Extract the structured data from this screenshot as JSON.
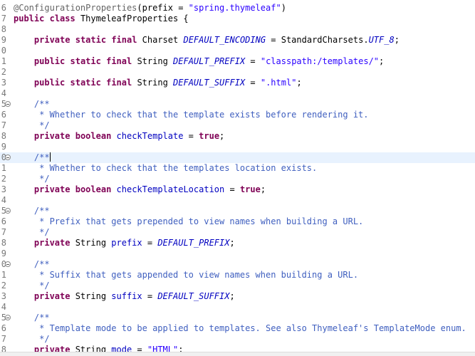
{
  "editor": {
    "lines": [
      {
        "num": "6",
        "fold": false,
        "current": false,
        "tokens": [
          {
            "t": "@ConfigurationProperties",
            "c": "ann"
          },
          {
            "t": "(prefix = ",
            "c": "plain"
          },
          {
            "t": "\"spring.thymeleaf\"",
            "c": "str"
          },
          {
            "t": ")",
            "c": "plain"
          }
        ]
      },
      {
        "num": "7",
        "fold": false,
        "current": false,
        "tokens": [
          {
            "t": "public",
            "c": "kw"
          },
          {
            "t": " ",
            "c": "plain"
          },
          {
            "t": "class",
            "c": "kw"
          },
          {
            "t": " ThymeleafProperties {",
            "c": "plain"
          }
        ]
      },
      {
        "num": "8",
        "fold": false,
        "current": false,
        "tokens": []
      },
      {
        "num": "9",
        "fold": false,
        "current": false,
        "tokens": [
          {
            "t": "    ",
            "c": "plain"
          },
          {
            "t": "private",
            "c": "kw"
          },
          {
            "t": " ",
            "c": "plain"
          },
          {
            "t": "static",
            "c": "kw"
          },
          {
            "t": " ",
            "c": "plain"
          },
          {
            "t": "final",
            "c": "kw"
          },
          {
            "t": " Charset ",
            "c": "plain"
          },
          {
            "t": "DEFAULT_ENCODING",
            "c": "const"
          },
          {
            "t": " = StandardCharsets.",
            "c": "plain"
          },
          {
            "t": "UTF_8",
            "c": "const"
          },
          {
            "t": ";",
            "c": "plain"
          }
        ]
      },
      {
        "num": "0",
        "fold": false,
        "current": false,
        "tokens": []
      },
      {
        "num": "1",
        "fold": false,
        "current": false,
        "tokens": [
          {
            "t": "    ",
            "c": "plain"
          },
          {
            "t": "public",
            "c": "kw"
          },
          {
            "t": " ",
            "c": "plain"
          },
          {
            "t": "static",
            "c": "kw"
          },
          {
            "t": " ",
            "c": "plain"
          },
          {
            "t": "final",
            "c": "kw"
          },
          {
            "t": " String ",
            "c": "plain"
          },
          {
            "t": "DEFAULT_PREFIX",
            "c": "const"
          },
          {
            "t": " = ",
            "c": "plain"
          },
          {
            "t": "\"classpath:/templates/\"",
            "c": "str"
          },
          {
            "t": ";",
            "c": "plain"
          }
        ]
      },
      {
        "num": "2",
        "fold": false,
        "current": false,
        "tokens": []
      },
      {
        "num": "3",
        "fold": false,
        "current": false,
        "tokens": [
          {
            "t": "    ",
            "c": "plain"
          },
          {
            "t": "public",
            "c": "kw"
          },
          {
            "t": " ",
            "c": "plain"
          },
          {
            "t": "static",
            "c": "kw"
          },
          {
            "t": " ",
            "c": "plain"
          },
          {
            "t": "final",
            "c": "kw"
          },
          {
            "t": " String ",
            "c": "plain"
          },
          {
            "t": "DEFAULT_SUFFIX",
            "c": "const"
          },
          {
            "t": " = ",
            "c": "plain"
          },
          {
            "t": "\".html\"",
            "c": "str"
          },
          {
            "t": ";",
            "c": "plain"
          }
        ]
      },
      {
        "num": "4",
        "fold": false,
        "current": false,
        "tokens": []
      },
      {
        "num": "5",
        "fold": true,
        "current": false,
        "tokens": [
          {
            "t": "    /**",
            "c": "doc"
          }
        ]
      },
      {
        "num": "6",
        "fold": false,
        "current": false,
        "tokens": [
          {
            "t": "     * Whether to check that the template exists before rendering it.",
            "c": "doc"
          }
        ]
      },
      {
        "num": "7",
        "fold": false,
        "current": false,
        "tokens": [
          {
            "t": "     */",
            "c": "doc"
          }
        ]
      },
      {
        "num": "8",
        "fold": false,
        "current": false,
        "tokens": [
          {
            "t": "    ",
            "c": "plain"
          },
          {
            "t": "private",
            "c": "kw"
          },
          {
            "t": " ",
            "c": "plain"
          },
          {
            "t": "boolean",
            "c": "kw"
          },
          {
            "t": " ",
            "c": "plain"
          },
          {
            "t": "checkTemplate",
            "c": "field"
          },
          {
            "t": " = ",
            "c": "plain"
          },
          {
            "t": "true",
            "c": "kw"
          },
          {
            "t": ";",
            "c": "plain"
          }
        ]
      },
      {
        "num": "9",
        "fold": false,
        "current": false,
        "tokens": []
      },
      {
        "num": "0",
        "fold": true,
        "current": true,
        "caret_after": 0,
        "tokens": [
          {
            "t": "    /**",
            "c": "doc"
          }
        ]
      },
      {
        "num": "1",
        "fold": false,
        "current": false,
        "tokens": [
          {
            "t": "     * Whether to check that the templates location exists.",
            "c": "doc"
          }
        ]
      },
      {
        "num": "2",
        "fold": false,
        "current": false,
        "tokens": [
          {
            "t": "     */",
            "c": "doc"
          }
        ]
      },
      {
        "num": "3",
        "fold": false,
        "current": false,
        "tokens": [
          {
            "t": "    ",
            "c": "plain"
          },
          {
            "t": "private",
            "c": "kw"
          },
          {
            "t": " ",
            "c": "plain"
          },
          {
            "t": "boolean",
            "c": "kw"
          },
          {
            "t": " ",
            "c": "plain"
          },
          {
            "t": "checkTemplateLocation",
            "c": "field"
          },
          {
            "t": " = ",
            "c": "plain"
          },
          {
            "t": "true",
            "c": "kw"
          },
          {
            "t": ";",
            "c": "plain"
          }
        ]
      },
      {
        "num": "4",
        "fold": false,
        "current": false,
        "tokens": []
      },
      {
        "num": "5",
        "fold": true,
        "current": false,
        "tokens": [
          {
            "t": "    /**",
            "c": "doc"
          }
        ]
      },
      {
        "num": "6",
        "fold": false,
        "current": false,
        "tokens": [
          {
            "t": "     * Prefix that gets prepended to view names when building a URL.",
            "c": "doc"
          }
        ]
      },
      {
        "num": "7",
        "fold": false,
        "current": false,
        "tokens": [
          {
            "t": "     */",
            "c": "doc"
          }
        ]
      },
      {
        "num": "8",
        "fold": false,
        "current": false,
        "tokens": [
          {
            "t": "    ",
            "c": "plain"
          },
          {
            "t": "private",
            "c": "kw"
          },
          {
            "t": " String ",
            "c": "plain"
          },
          {
            "t": "prefix",
            "c": "field"
          },
          {
            "t": " = ",
            "c": "plain"
          },
          {
            "t": "DEFAULT_PREFIX",
            "c": "const"
          },
          {
            "t": ";",
            "c": "plain"
          }
        ]
      },
      {
        "num": "9",
        "fold": false,
        "current": false,
        "tokens": []
      },
      {
        "num": "0",
        "fold": true,
        "current": false,
        "tokens": [
          {
            "t": "    /**",
            "c": "doc"
          }
        ]
      },
      {
        "num": "1",
        "fold": false,
        "current": false,
        "tokens": [
          {
            "t": "     * Suffix that gets appended to view names when building a URL.",
            "c": "doc"
          }
        ]
      },
      {
        "num": "2",
        "fold": false,
        "current": false,
        "tokens": [
          {
            "t": "     */",
            "c": "doc"
          }
        ]
      },
      {
        "num": "3",
        "fold": false,
        "current": false,
        "tokens": [
          {
            "t": "    ",
            "c": "plain"
          },
          {
            "t": "private",
            "c": "kw"
          },
          {
            "t": " String ",
            "c": "plain"
          },
          {
            "t": "suffix",
            "c": "field"
          },
          {
            "t": " = ",
            "c": "plain"
          },
          {
            "t": "DEFAULT_SUFFIX",
            "c": "const"
          },
          {
            "t": ";",
            "c": "plain"
          }
        ]
      },
      {
        "num": "4",
        "fold": false,
        "current": false,
        "tokens": []
      },
      {
        "num": "5",
        "fold": true,
        "current": false,
        "tokens": [
          {
            "t": "    /**",
            "c": "doc"
          }
        ]
      },
      {
        "num": "6",
        "fold": false,
        "current": false,
        "tokens": [
          {
            "t": "     * Template mode to be applied to templates. See also Thymeleaf's TemplateMode enum.",
            "c": "doc"
          }
        ]
      },
      {
        "num": "7",
        "fold": false,
        "current": false,
        "tokens": [
          {
            "t": "     */",
            "c": "doc"
          }
        ]
      },
      {
        "num": "8",
        "fold": false,
        "current": false,
        "tokens": [
          {
            "t": "    ",
            "c": "plain"
          },
          {
            "t": "private",
            "c": "kw"
          },
          {
            "t": " String ",
            "c": "plain"
          },
          {
            "t": "mode",
            "c": "field"
          },
          {
            "t": " = ",
            "c": "plain"
          },
          {
            "t": "\"HTML\"",
            "c": "str"
          },
          {
            "t": ";",
            "c": "plain"
          }
        ]
      }
    ]
  }
}
